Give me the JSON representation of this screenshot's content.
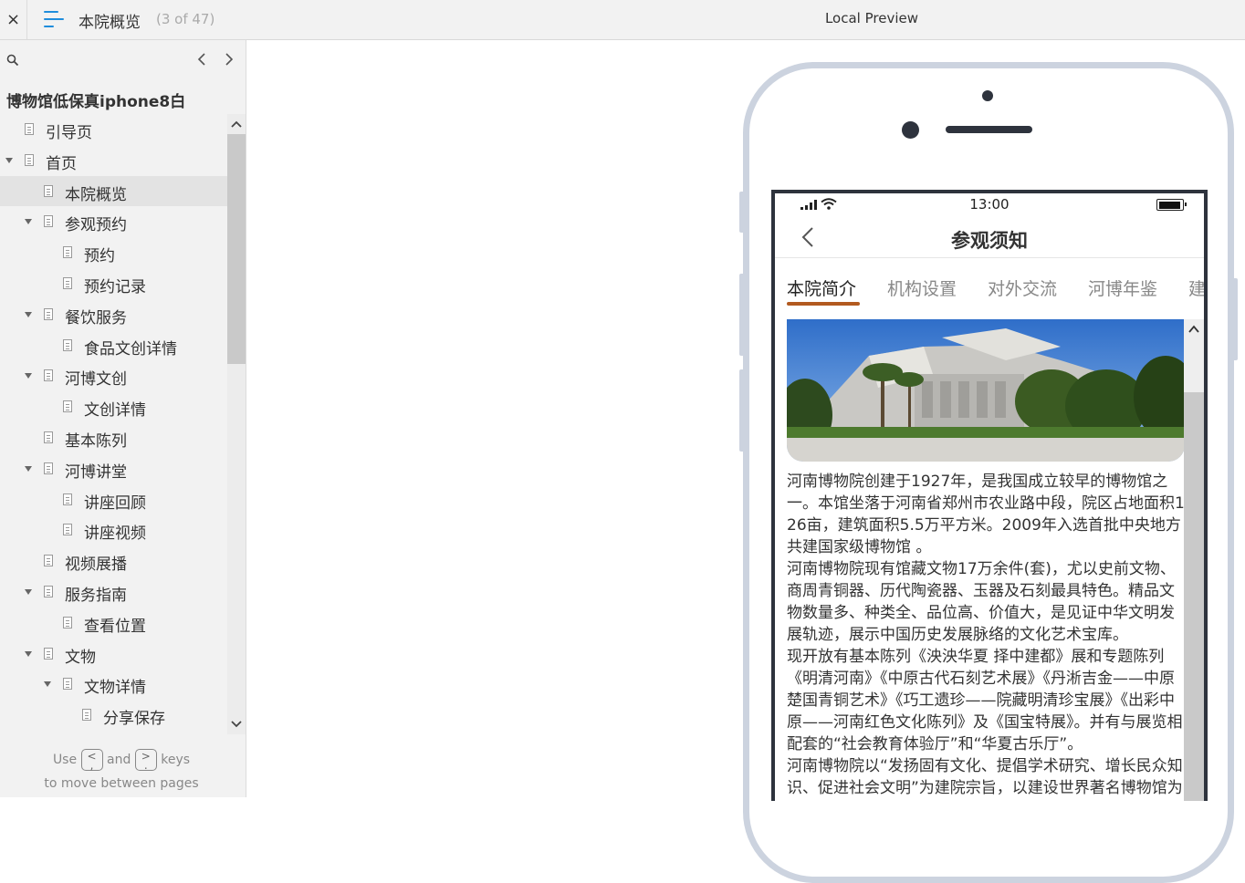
{
  "topbar": {
    "close_label": "×",
    "page_title": "本院概览",
    "page_count": "(3 of 47)",
    "preview_label": "Local Preview"
  },
  "sidebar": {
    "project_title": "博物馆低保真iphone8白",
    "items": [
      {
        "label": "引导页",
        "level": 0,
        "expanded": false,
        "has_children": false,
        "selected": false
      },
      {
        "label": "首页",
        "level": 0,
        "expanded": true,
        "has_children": true,
        "selected": false
      },
      {
        "label": "本院概览",
        "level": 1,
        "expanded": false,
        "has_children": false,
        "selected": true
      },
      {
        "label": "参观预约",
        "level": 1,
        "expanded": true,
        "has_children": true,
        "selected": false
      },
      {
        "label": "预约",
        "level": 2,
        "expanded": false,
        "has_children": false,
        "selected": false
      },
      {
        "label": "预约记录",
        "level": 2,
        "expanded": false,
        "has_children": false,
        "selected": false
      },
      {
        "label": "餐饮服务",
        "level": 1,
        "expanded": true,
        "has_children": true,
        "selected": false
      },
      {
        "label": "食品文创详情",
        "level": 2,
        "expanded": false,
        "has_children": false,
        "selected": false
      },
      {
        "label": "河博文创",
        "level": 1,
        "expanded": true,
        "has_children": true,
        "selected": false
      },
      {
        "label": "文创详情",
        "level": 2,
        "expanded": false,
        "has_children": false,
        "selected": false
      },
      {
        "label": "基本陈列",
        "level": 1,
        "expanded": false,
        "has_children": false,
        "selected": false
      },
      {
        "label": "河博讲堂",
        "level": 1,
        "expanded": true,
        "has_children": true,
        "selected": false
      },
      {
        "label": "讲座回顾",
        "level": 2,
        "expanded": false,
        "has_children": false,
        "selected": false
      },
      {
        "label": "讲座视频",
        "level": 2,
        "expanded": false,
        "has_children": false,
        "selected": false
      },
      {
        "label": "视频展播",
        "level": 1,
        "expanded": false,
        "has_children": false,
        "selected": false
      },
      {
        "label": "服务指南",
        "level": 1,
        "expanded": true,
        "has_children": true,
        "selected": false
      },
      {
        "label": "查看位置",
        "level": 2,
        "expanded": false,
        "has_children": false,
        "selected": false
      },
      {
        "label": "文物",
        "level": 1,
        "expanded": true,
        "has_children": true,
        "selected": false
      },
      {
        "label": "文物详情",
        "level": 2,
        "expanded": true,
        "has_children": true,
        "selected": false
      },
      {
        "label": "分享保存",
        "level": 3,
        "expanded": false,
        "has_children": false,
        "selected": false
      }
    ],
    "hint": {
      "use": "Use",
      "key_prev": "<\n,",
      "and": "and",
      "key_next": ">\n.",
      "keys": "keys",
      "line2": "to move between pages"
    }
  },
  "phone": {
    "status_time": "13:00",
    "nav_title": "参观须知",
    "tabs": [
      "本院简介",
      "机构设置",
      "对外交流",
      "河博年鉴",
      "建"
    ],
    "active_tab": 0,
    "accent_color": "#b25a1f",
    "article": [
      "河南博物院创建于1927年，是我国成立较早的博物馆之一。本馆坐落于河南省郑州市农业路中段，院区占地面积126亩，建筑面积5.5万平方米。2009年入选首批中央地方共建国家级博物馆 。",
      "河南博物院现有馆藏文物17万余件(套)，尤以史前文物、商周青铜器、历代陶瓷器、玉器及石刻最具特色。精品文物数量多、种类全、品位高、价值大，是见证中华文明发展轨迹，展示中国历史发展脉络的文化艺术宝库。",
      "现开放有基本陈列《泱泱华夏 择中建都》展和专题陈列《明清河南》《中原古代石刻艺术展》《丹淅吉金——中原楚国青铜艺术》《巧工遗珍——院藏明清珍宝展》《出彩中原——河南红色文化陈列》及《国宝特展》。并有与展览相配套的“社会教育体验厅”和“华夏古乐厅”。",
      "河南博物院以“发扬固有文化、提倡学术研究、增长民众知识、促进社会文明”为建院宗旨，以建设世界著名博物馆为目标。"
    ]
  }
}
